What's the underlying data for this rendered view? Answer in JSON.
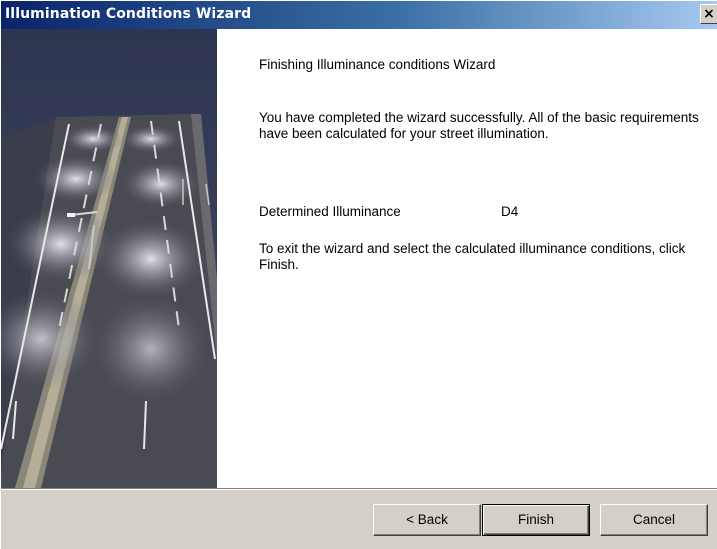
{
  "window": {
    "title": "Illumination Conditions Wizard",
    "close_glyph": "×"
  },
  "side_image": {
    "description_icon": "street-lighting-illustration"
  },
  "body": {
    "heading": "Finishing Illuminance conditions Wizard",
    "completed_text": "You have completed the wizard successfully. All of the basic requirements have been calculated for your street illumination.",
    "illuminance_label": "Determined Illuminance",
    "illuminance_value": "D4",
    "exit_text": "To exit the wizard and select the calculated illuminance conditions, click Finish."
  },
  "buttons": {
    "back": "< Back",
    "finish": "Finish",
    "cancel": "Cancel"
  },
  "colors": {
    "title_start": "#0a246a",
    "title_end": "#a6caf0",
    "dialog_face": "#d4d0c8",
    "content_bg": "#ffffff"
  }
}
